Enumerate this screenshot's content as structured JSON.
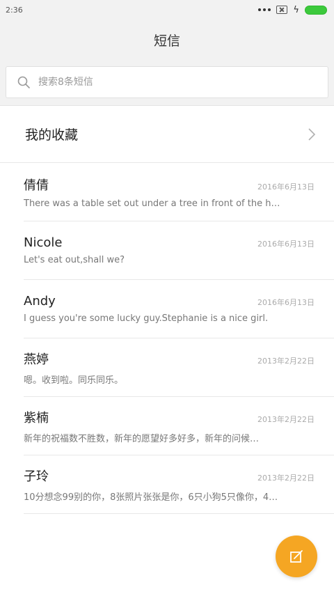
{
  "status_bar": {
    "time": "2:36"
  },
  "header": {
    "title": "短信"
  },
  "search": {
    "placeholder": "搜索8条短信",
    "value": ""
  },
  "favorites": {
    "label": "我的收藏"
  },
  "conversations": [
    {
      "name": "倩倩",
      "date": "2016年6月13日",
      "preview": "There was a table set out under a tree in front of the h…"
    },
    {
      "name": "Nicole",
      "date": "2016年6月13日",
      "preview": "Let's eat out,shall we?"
    },
    {
      "name": "Andy",
      "date": "2016年6月13日",
      "preview": "I guess you're some lucky guy.Stephanie is a nice girl."
    },
    {
      "name": "燕婷",
      "date": "2013年2月22日",
      "preview": "嗯。收到啦。同乐同乐。"
    },
    {
      "name": "紫楠",
      "date": "2013年2月22日",
      "preview": "新年的祝福数不胜数，新年的愿望好多好多，新年的问候…"
    },
    {
      "name": "子玲",
      "date": "2013年2月22日",
      "preview": "10分想念99别的你，8张照片张张是你，6只小狗5只像你，4…"
    }
  ],
  "colors": {
    "fab": "#f5a623",
    "battery": "#3cc93c",
    "header_bg": "#f2f2f2"
  },
  "icons": {
    "search": "search-icon",
    "chevron": "chevron-right-icon",
    "compose": "compose-icon",
    "battery": "battery-icon",
    "sim": "no-sim-icon",
    "charging": "charging-bolt-icon"
  }
}
